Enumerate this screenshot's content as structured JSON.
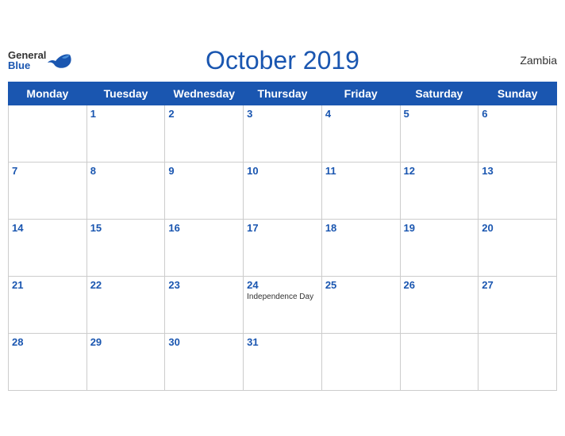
{
  "header": {
    "logo_general": "General",
    "logo_blue": "Blue",
    "month_title": "October 2019",
    "country": "Zambia"
  },
  "days_of_week": [
    "Monday",
    "Tuesday",
    "Wednesday",
    "Thursday",
    "Friday",
    "Saturday",
    "Sunday"
  ],
  "weeks": [
    [
      {
        "num": "",
        "holiday": ""
      },
      {
        "num": "1",
        "holiday": ""
      },
      {
        "num": "2",
        "holiday": ""
      },
      {
        "num": "3",
        "holiday": ""
      },
      {
        "num": "4",
        "holiday": ""
      },
      {
        "num": "5",
        "holiday": ""
      },
      {
        "num": "6",
        "holiday": ""
      }
    ],
    [
      {
        "num": "7",
        "holiday": ""
      },
      {
        "num": "8",
        "holiday": ""
      },
      {
        "num": "9",
        "holiday": ""
      },
      {
        "num": "10",
        "holiday": ""
      },
      {
        "num": "11",
        "holiday": ""
      },
      {
        "num": "12",
        "holiday": ""
      },
      {
        "num": "13",
        "holiday": ""
      }
    ],
    [
      {
        "num": "14",
        "holiday": ""
      },
      {
        "num": "15",
        "holiday": ""
      },
      {
        "num": "16",
        "holiday": ""
      },
      {
        "num": "17",
        "holiday": ""
      },
      {
        "num": "18",
        "holiday": ""
      },
      {
        "num": "19",
        "holiday": ""
      },
      {
        "num": "20",
        "holiday": ""
      }
    ],
    [
      {
        "num": "21",
        "holiday": ""
      },
      {
        "num": "22",
        "holiday": ""
      },
      {
        "num": "23",
        "holiday": ""
      },
      {
        "num": "24",
        "holiday": "Independence Day"
      },
      {
        "num": "25",
        "holiday": ""
      },
      {
        "num": "26",
        "holiday": ""
      },
      {
        "num": "27",
        "holiday": ""
      }
    ],
    [
      {
        "num": "28",
        "holiday": ""
      },
      {
        "num": "29",
        "holiday": ""
      },
      {
        "num": "30",
        "holiday": ""
      },
      {
        "num": "31",
        "holiday": ""
      },
      {
        "num": "",
        "holiday": ""
      },
      {
        "num": "",
        "holiday": ""
      },
      {
        "num": "",
        "holiday": ""
      }
    ]
  ]
}
